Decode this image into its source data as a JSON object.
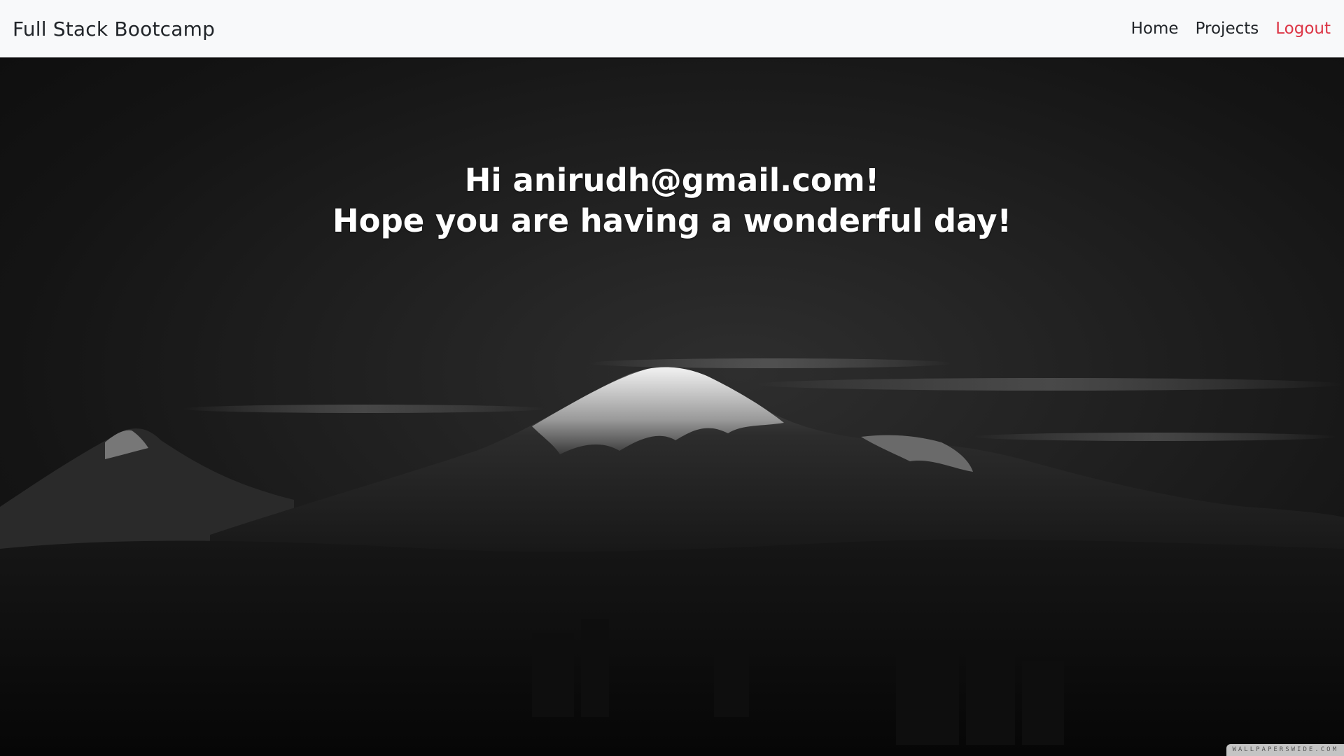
{
  "navbar": {
    "brand": "Full Stack Bootcamp",
    "links": [
      {
        "label": "Home"
      },
      {
        "label": "Projects"
      },
      {
        "label": "Logout",
        "color": "#dc3545"
      }
    ]
  },
  "hero": {
    "greeting_line1": "Hi anirudh@gmail.com!",
    "greeting_line2": "Hope you are having a wonderful day!",
    "background": "black-and-white mountain landscape photo",
    "watermark": "WALLPAPERSWIDE.COM"
  },
  "colors": {
    "navbar_bg": "#f8f9fa",
    "text_dark": "#212529",
    "logout": "#dc3545",
    "greeting_text": "#ffffff"
  }
}
